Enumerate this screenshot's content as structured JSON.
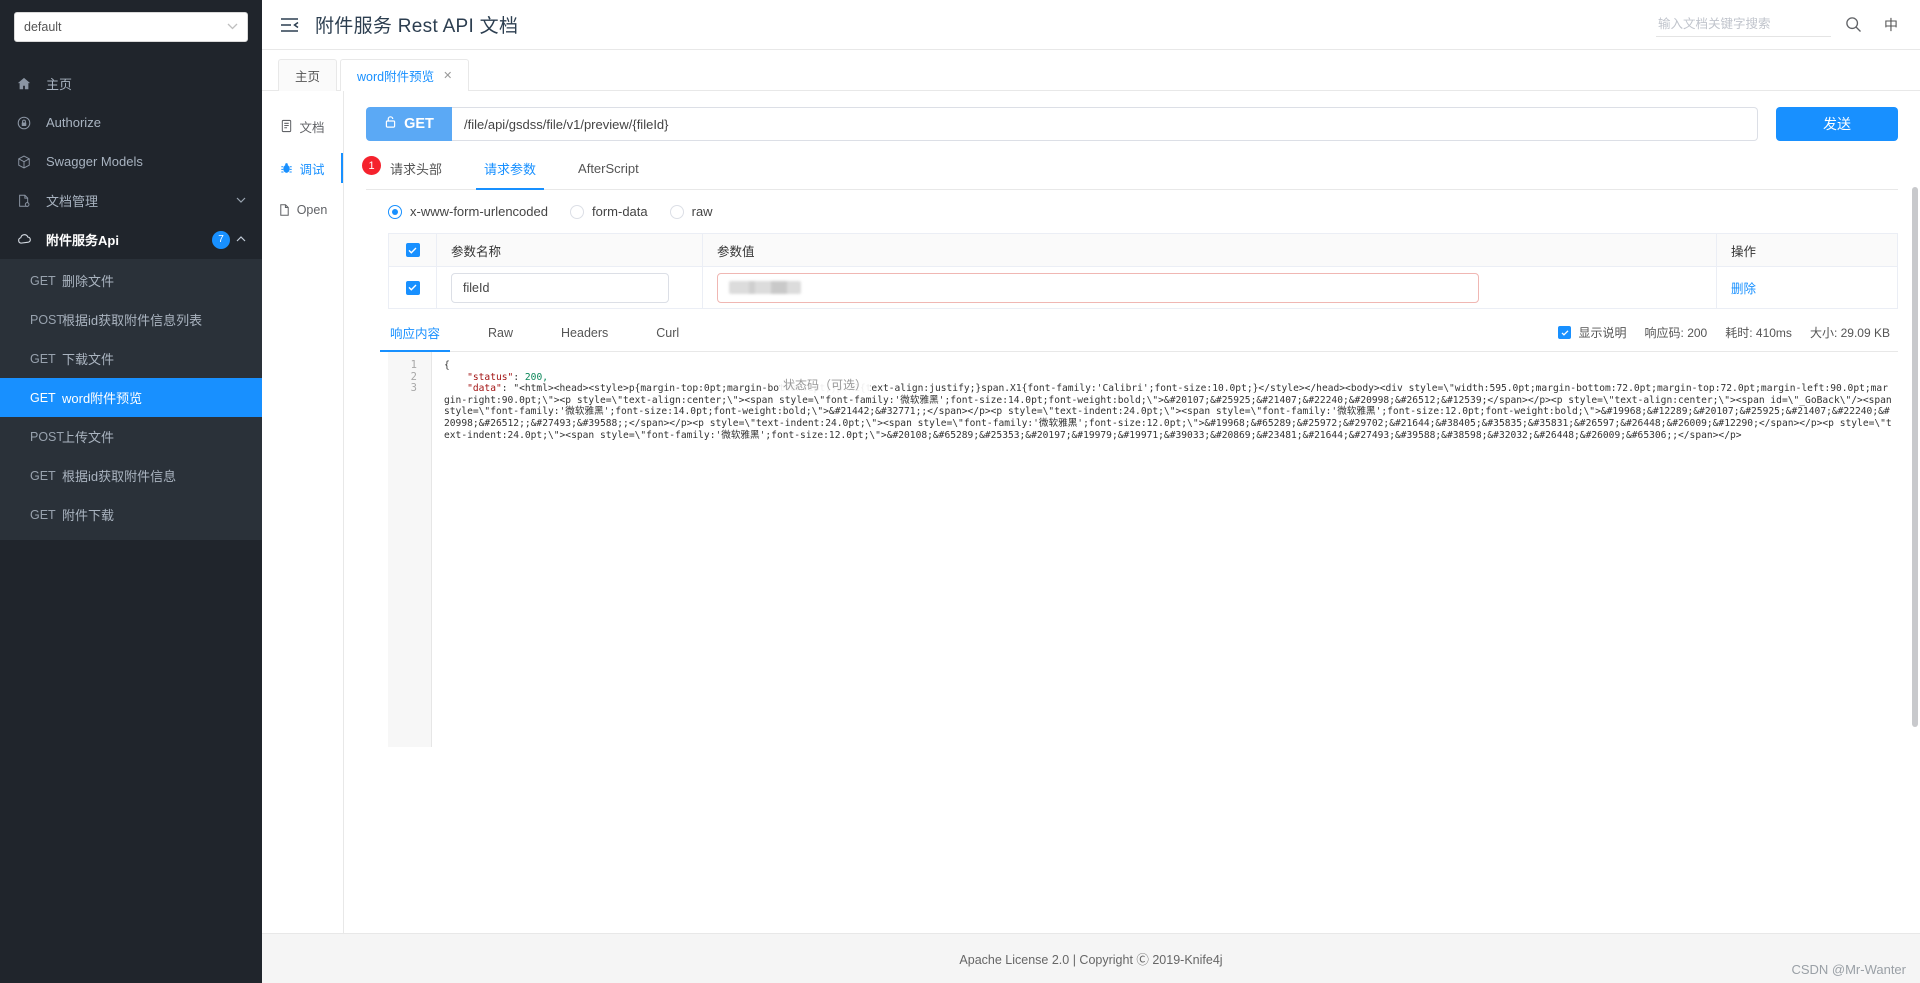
{
  "sidebar": {
    "group_select": {
      "value": "default",
      "icon": "chevron-down-icon"
    },
    "nav": [
      {
        "label": "主页",
        "icon": "home-icon"
      },
      {
        "label": "Authorize",
        "icon": "lock-icon"
      },
      {
        "label": "Swagger Models",
        "icon": "cube-icon"
      },
      {
        "label": "文档管理",
        "icon": "document-settings-icon"
      }
    ],
    "api_group": {
      "label": "附件服务Api",
      "icon": "cloud-icon",
      "count": "7",
      "caret": "caret-up-icon"
    },
    "endpoints": [
      {
        "method": "GET",
        "name": "删除文件",
        "active": false
      },
      {
        "method": "POST",
        "name": "根据id获取附件信息列表",
        "active": false
      },
      {
        "method": "GET",
        "name": "下载文件",
        "active": false
      },
      {
        "method": "GET",
        "name": "word附件预览",
        "active": true
      },
      {
        "method": "POST",
        "name": "上传文件",
        "active": false
      },
      {
        "method": "GET",
        "name": "根据id获取附件信息",
        "active": false
      },
      {
        "method": "GET",
        "name": "附件下载",
        "active": false
      }
    ]
  },
  "header": {
    "menu_fold_icon": "menu-fold-icon",
    "title": "附件服务 Rest API 文档",
    "search_placeholder": "输入文档关键字搜索",
    "search_value": "",
    "search_icon": "search-icon",
    "lang_label": "中"
  },
  "tabs": [
    {
      "label": "主页",
      "active": false,
      "closable": false
    },
    {
      "label": "word附件预览",
      "active": true,
      "closable": true,
      "close": "✕"
    }
  ],
  "leftnav": [
    {
      "label": "文档",
      "icon": "document-icon",
      "active": false
    },
    {
      "label": "调试",
      "icon": "bug-icon",
      "active": true
    },
    {
      "label": "Open",
      "icon": "open-file-icon",
      "active": false
    }
  ],
  "request": {
    "method": "GET",
    "lock_icon": "unlock-icon",
    "url": "/file/api/gsdss/file/v1/preview/{fileId}",
    "send_label": "发送",
    "tabs": [
      {
        "label": "请求头部",
        "badge": "1",
        "active": false
      },
      {
        "label": "请求参数",
        "badge": "",
        "active": true
      },
      {
        "label": "AfterScript",
        "badge": "",
        "active": false
      }
    ],
    "body_types": [
      {
        "label": "x-www-form-urlencoded",
        "selected": true
      },
      {
        "label": "form-data",
        "selected": false
      },
      {
        "label": "raw",
        "selected": false
      }
    ],
    "table": {
      "headers": {
        "name": "参数名称",
        "value": "参数值",
        "action": "操作"
      },
      "rows": [
        {
          "checked": true,
          "name": "fileId",
          "value": "",
          "value_redacted": true,
          "action": "删除"
        }
      ]
    }
  },
  "response": {
    "tabs": [
      {
        "label": "响应内容",
        "active": true
      },
      {
        "label": "Raw",
        "active": false
      },
      {
        "label": "Headers",
        "active": false
      },
      {
        "label": "Curl",
        "active": false
      }
    ],
    "show_desc_label": "显示说明",
    "show_desc_checked": true,
    "status_label": "响应码:",
    "status_value": "200",
    "time_label": "耗时:",
    "time_value": "410ms",
    "size_label": "大小:",
    "size_value": "29.09 KB",
    "tooltip": "状态码（可选）",
    "line_numbers": [
      "1",
      "2",
      "3"
    ],
    "code_line_1": "{",
    "code_line_2_key": "\"status\"",
    "code_line_2_val": "200,",
    "code_line_3_key": "\"data\"",
    "code_body": ": \"<html><head><style>p{margin-top:0pt;margin-bottom:1pt;}p.X1{text-align:justify;}span.X1{font-family:'Calibri';font-size:10.0pt;}</style></head><body><div style=\\\"width:595.0pt;margin-bottom:72.0pt;margin-top:72.0pt;margin-left:90.0pt;margin-right:90.0pt;\\\"><p style=\\\"text-align:center;\\\"><span style=\\\"font-family:'微软雅黑';font-size:14.0pt;font-weight:bold;\\\">&#20107;&#25925;&#21407;&#22240;&#20998;&#26512;&#12539;</span></p><p style=\\\"text-align:center;\\\"><span id=\\\"_GoBack\\\"/><span style=\\\"font-family:'微软雅黑';font-size:14.0pt;font-weight:bold;\\\">&#21442;&#32771;;</span></p><p style=\\\"text-indent:24.0pt;\\\"><span style=\\\"font-family:'微软雅黑';font-size:12.0pt;font-weight:bold;\\\">&#19968;&#12289;&#20107;&#25925;&#21407;&#22240;&#20998;&#26512;;&#27493;&#39588;;</span></p><p style=\\\"text-indent:24.0pt;\\\"><span style=\\\"font-family:'微软雅黑';font-size:12.0pt;\\\">&#19968;&#65289;&#25972;&#29702;&#21644;&#38405;&#35835;&#35831;&#26597;&#26448;&#26009;&#12290;</span></p><p style=\\\"text-indent:24.0pt;\\\"><span style=\\\"font-family:'微软雅黑';font-size:12.0pt;\\\">&#20108;&#65289;&#25353;&#20197;&#19979;&#19971;&#39033;&#20869;&#23481;&#21644;&#27493;&#39588;&#38598;&#32032;&#26448;&#26009;&#65306;;</span></p>"
  },
  "footer": {
    "text": "Apache License 2.0 | Copyright Ⓒ 2019-Knife4j",
    "watermark": "CSDN @Mr-Wanter"
  }
}
